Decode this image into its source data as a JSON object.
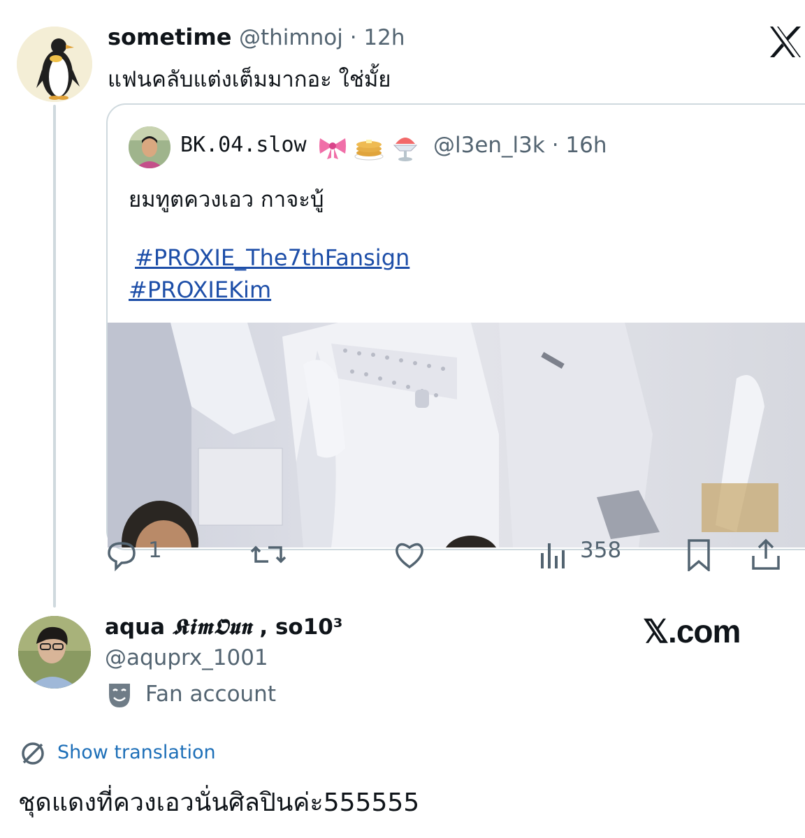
{
  "top_tweet": {
    "author_name": "sometime",
    "meta": "@thimnoj · 12h",
    "text": "แฟนคลับแต่งเต็มมากอะ ใช่มั้ย",
    "avatar_icon": "penguin-avatar",
    "brand_icon": "x-logo-icon"
  },
  "quoted_tweet": {
    "author_name": "BK.04.slow",
    "emoji_icons": [
      "ribbon-icon",
      "pancakes-icon",
      "shaved-ice-icon"
    ],
    "meta": "@l3en_l3k · 16h",
    "text": "ยมทูตควงเอว กาจะบู้",
    "hashtags": [
      "#PROXIE_The7thFansign",
      "#PROXIEKim"
    ],
    "media": "photo"
  },
  "actions": {
    "reply_count": "1",
    "views_count": "358",
    "icons": [
      "reply-icon",
      "repost-icon",
      "like-icon",
      "views-icon",
      "bookmark-icon",
      "share-icon"
    ]
  },
  "profile": {
    "name_prefix": "aqua",
    "name_styled": "𝕶𝖎𝖒𝕺𝖚𝖓",
    "name_suffix": ", so10³",
    "handle": "@aquprx_1001",
    "badge_label": "Fan account",
    "watermark": "𝕏.com"
  },
  "reply": {
    "translate_label": "Show translation",
    "text": "ชุดแดงที่ควงเอวนั่นศิลปินค่ะ555555"
  },
  "colors": {
    "text": "#0f1419",
    "secondary": "#536471",
    "link": "#1d4ea8",
    "translate_link": "#1d6fb8",
    "border": "#cfd9de"
  }
}
